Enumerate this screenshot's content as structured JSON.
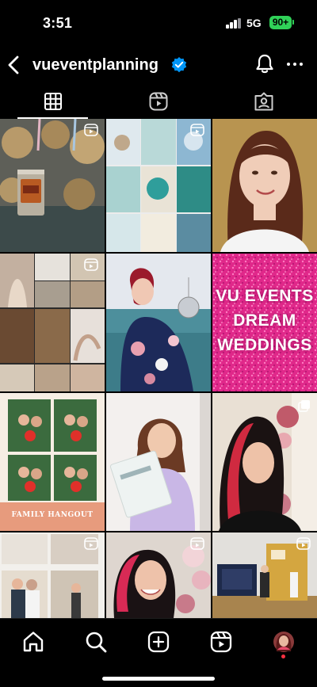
{
  "status_bar": {
    "time": "3:51",
    "network": "5G",
    "battery": "90+"
  },
  "header": {
    "username": "vueventplanning"
  },
  "tabs": [
    {
      "icon": "grid-icon",
      "active": true
    },
    {
      "icon": "reels-icon",
      "active": false
    },
    {
      "icon": "tagged-icon",
      "active": false
    }
  ],
  "posts": {
    "promo_text_lines": [
      "VU EVENTS",
      "DREAM",
      "WEDDINGS"
    ],
    "photo_strip_caption": "FAMILY HANGOUT"
  },
  "bottom_nav": [
    {
      "icon": "home-icon"
    },
    {
      "icon": "search-icon"
    },
    {
      "icon": "create-icon"
    },
    {
      "icon": "reels-icon"
    },
    {
      "icon": "profile-avatar"
    }
  ],
  "colors": {
    "verified_blue": "#0095f6",
    "battery_green": "#30d158",
    "notification_red": "#ff3040",
    "glitter_pink": "#e0288a"
  }
}
